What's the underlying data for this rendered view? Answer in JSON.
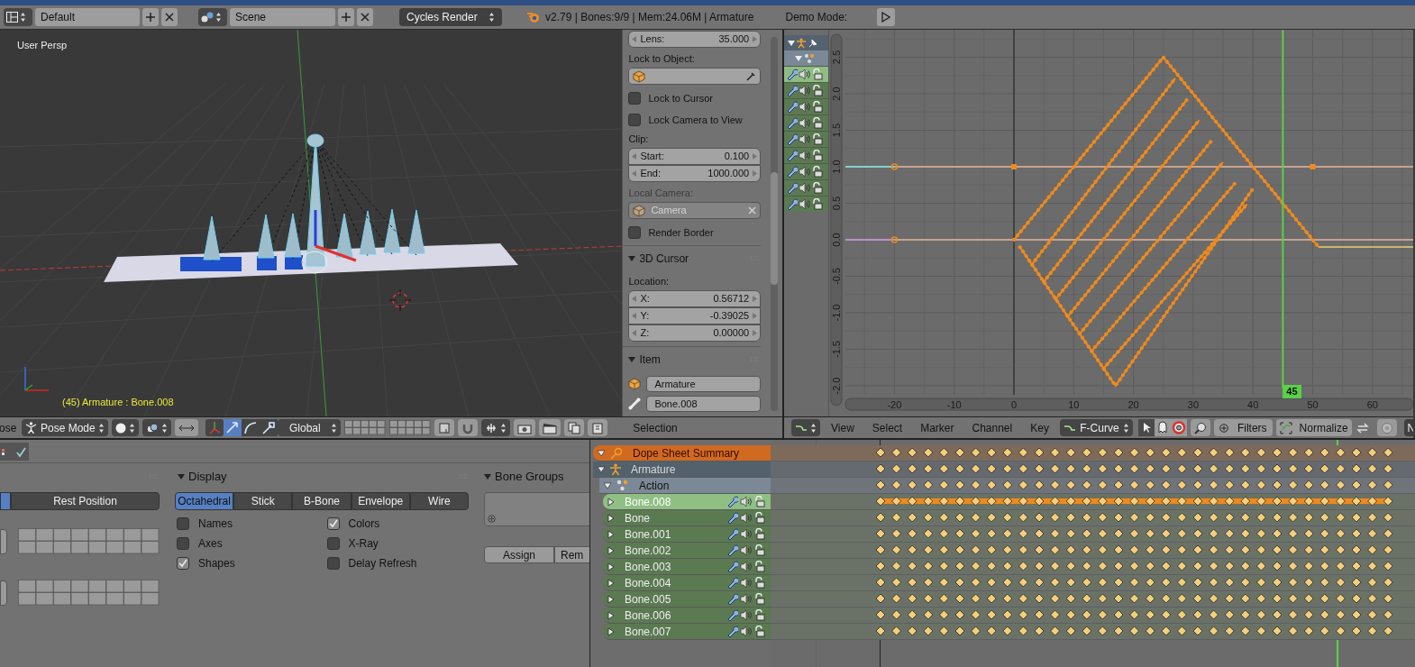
{
  "top_bar": {
    "screen_layout": "Default",
    "scene": "Scene",
    "render_engine": "Cycles Render",
    "stats": "v2.79 | Bones:9/9 | Mem:24.06M | Armature",
    "demo_mode": "Demo Mode:"
  },
  "viewport": {
    "view_label": "User Persp",
    "object_info": "(45) Armature : Bone.008"
  },
  "view_panel": [
    {
      "kind": "number",
      "label": "Lens:",
      "value": "35.000"
    },
    {
      "kind": "label",
      "text": "Lock to Object:",
      "disabled": false
    },
    {
      "kind": "object_field",
      "disabled": false
    },
    {
      "kind": "checkbox",
      "label": "Lock to Cursor",
      "checked": false
    },
    {
      "kind": "checkbox",
      "label": "Lock Camera to View",
      "checked": false
    },
    {
      "kind": "label",
      "text": "Clip:",
      "disabled": false
    },
    {
      "kind": "number_group",
      "fields": [
        {
          "label": "Start:",
          "value": "0.100"
        },
        {
          "label": "End:",
          "value": "1000.000"
        }
      ]
    },
    {
      "kind": "label",
      "text": "Local Camera:",
      "disabled": true
    },
    {
      "kind": "object_field",
      "value": "Camera",
      "disabled": true
    },
    {
      "kind": "checkbox",
      "label": "Render Border",
      "checked": false
    },
    {
      "kind": "panel_header",
      "title": "3D Cursor",
      "expanded": true
    },
    {
      "kind": "label",
      "text": "Location:",
      "disabled": false
    },
    {
      "kind": "number_group",
      "fields": [
        {
          "label": "X:",
          "value": "0.56712"
        },
        {
          "label": "Y:",
          "value": "-0.39025"
        },
        {
          "label": "Z:",
          "value": "0.00000"
        }
      ]
    },
    {
      "kind": "panel_header",
      "title": "Item",
      "expanded": true
    },
    {
      "kind": "object_name",
      "value": "Armature"
    },
    {
      "kind": "bone_name",
      "value": "Bone.008"
    }
  ],
  "viewport_header": {
    "menu_cut": "ose",
    "mode": "Pose Mode",
    "orientation": "Global",
    "keying_set": "Selection",
    "manipulators": [
      {
        "kind": "translate",
        "selected": true
      },
      {
        "kind": "rotate",
        "selected": false
      },
      {
        "kind": "scale",
        "selected": false
      }
    ]
  },
  "graph": {
    "y_ticks": [
      "2.5",
      "2.0",
      "1.5",
      "1.0",
      "0.5",
      "0.0",
      "-0.5",
      "-1.0",
      "-1.5",
      "-2.0"
    ],
    "x_ticks": [
      "-20",
      "-10",
      "0",
      "10",
      "20",
      "30",
      "40",
      "50",
      "60"
    ],
    "current_frame": "45"
  },
  "graph_header": {
    "menus": [
      "View",
      "Select",
      "Marker",
      "Channel",
      "Key"
    ],
    "mode": "F-Curve",
    "filters": "Filters",
    "normalize": "Normalize",
    "cut_button": "N"
  },
  "properties": {
    "skeleton_panel": {
      "pose_position": [
        {
          "selected": true
        },
        {
          "label": "Rest Position",
          "selected": false
        }
      ]
    },
    "display_panel": {
      "title": "Display",
      "expanded": true,
      "draw_types": [
        {
          "label": "Octahedral",
          "selected": true
        },
        {
          "label": "Stick",
          "selected": false
        },
        {
          "label": "B-Bone",
          "selected": false
        },
        {
          "label": "Envelope",
          "selected": false
        },
        {
          "label": "Wire",
          "selected": false
        }
      ],
      "options": [
        {
          "label": "Names",
          "checked": false
        },
        {
          "label": "Colors",
          "checked": true
        },
        {
          "label": "Axes",
          "checked": false
        },
        {
          "label": "X-Ray",
          "checked": false
        },
        {
          "label": "Shapes",
          "checked": true
        },
        {
          "label": "Delay Refresh",
          "checked": false
        }
      ]
    },
    "bone_groups_panel": {
      "title": "Bone Groups",
      "expanded": true,
      "buttons": [
        "Assign",
        "Rem"
      ]
    }
  },
  "dopesheet": {
    "channels": [
      {
        "kind": "summary",
        "label": "Dope Sheet Summary",
        "expanded": true,
        "selected": false,
        "hold_bar": false
      },
      {
        "kind": "object",
        "label": "Armature",
        "expanded": true,
        "selected": false,
        "hold_bar": false
      },
      {
        "kind": "action",
        "label": "Action",
        "expanded": true,
        "selected": false,
        "hold_bar": false
      },
      {
        "kind": "group",
        "label": "Bone.008",
        "expanded": false,
        "selected": true,
        "hold_bar": true
      },
      {
        "kind": "group",
        "label": "Bone",
        "expanded": false,
        "selected": false,
        "hold_bar": false
      },
      {
        "kind": "group",
        "label": "Bone.001",
        "expanded": false,
        "selected": false,
        "hold_bar": false
      },
      {
        "kind": "group",
        "label": "Bone.002",
        "expanded": false,
        "selected": false,
        "hold_bar": false
      },
      {
        "kind": "group",
        "label": "Bone.003",
        "expanded": false,
        "selected": false,
        "hold_bar": false
      },
      {
        "kind": "group",
        "label": "Bone.004",
        "expanded": false,
        "selected": false,
        "hold_bar": false
      },
      {
        "kind": "group",
        "label": "Bone.005",
        "expanded": false,
        "selected": false,
        "hold_bar": false
      },
      {
        "kind": "group",
        "label": "Bone.006",
        "expanded": false,
        "selected": false,
        "hold_bar": false
      },
      {
        "kind": "group",
        "label": "Bone.007",
        "expanded": false,
        "selected": false,
        "hold_bar": false
      }
    ]
  }
}
